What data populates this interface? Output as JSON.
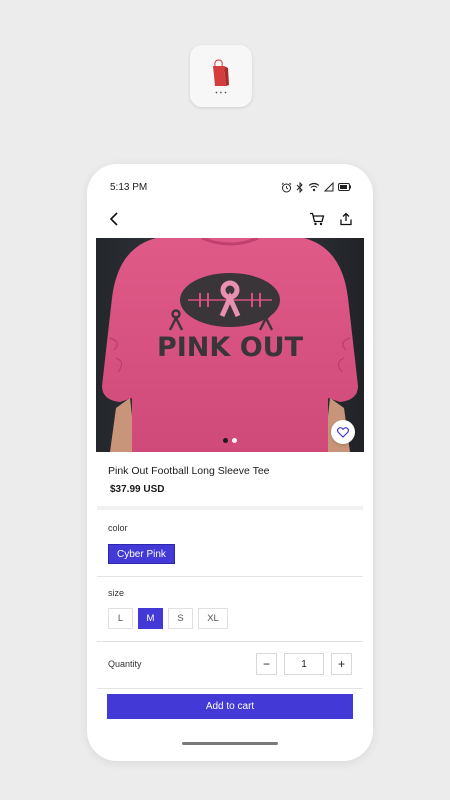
{
  "status_bar": {
    "time": "5:13 PM",
    "icons": [
      "alarm-icon",
      "bluetooth-icon",
      "wifi-icon",
      "signal-icon",
      "battery-icon"
    ]
  },
  "nav": {
    "icons": [
      "back-arrow-icon",
      "cart-icon",
      "share-icon"
    ]
  },
  "product": {
    "title": "Pink Out Football Long Sleeve Tee",
    "price": "$37.99 USD",
    "image_text": "PINK OUT",
    "carousel": {
      "count": 2,
      "active_index": 0
    }
  },
  "options": {
    "color_label": "color",
    "color_value": "Cyber Pink",
    "size_label": "size",
    "sizes": [
      "L",
      "M",
      "S",
      "XL"
    ],
    "selected_size": "M"
  },
  "quantity": {
    "label": "Quantity",
    "value": "1",
    "minus": "−",
    "plus": "+"
  },
  "actions": {
    "add_to_cart": "Add to cart"
  },
  "colors": {
    "accent": "#4339d6",
    "shirt": "#d94f80",
    "print": "#3a3538",
    "background": "#ececec"
  }
}
